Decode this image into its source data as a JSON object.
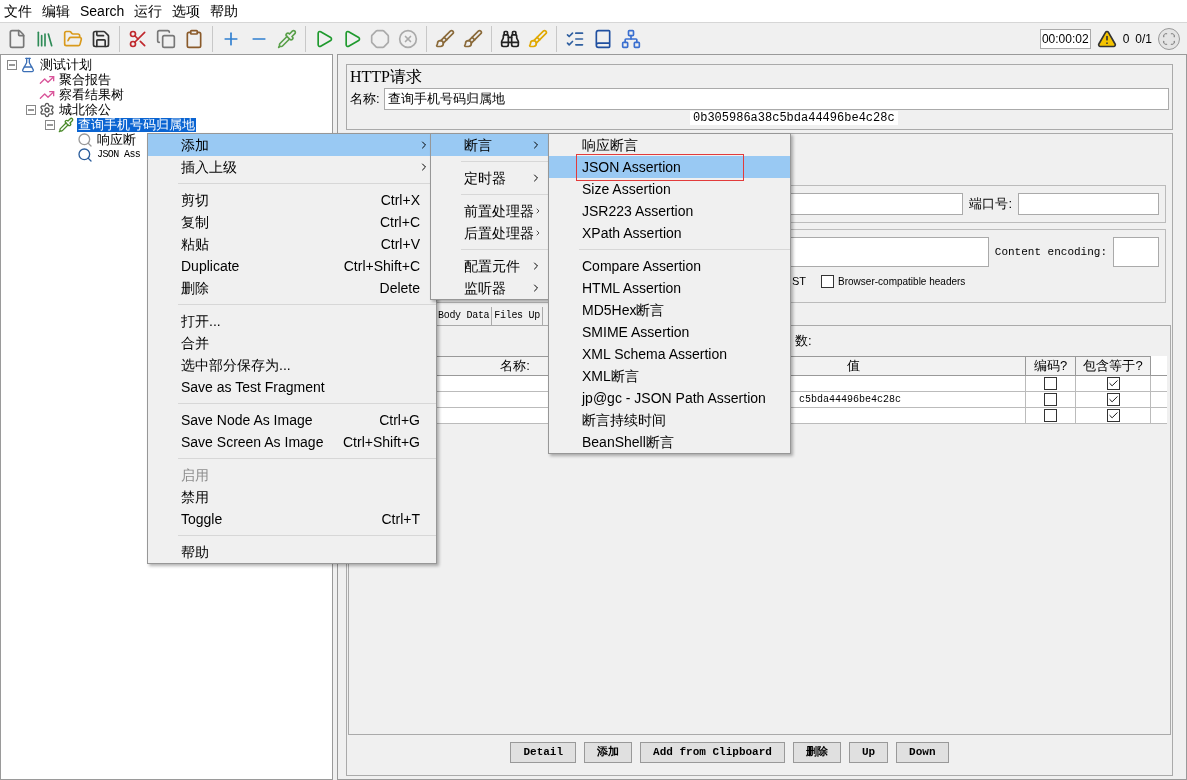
{
  "menubar": [
    {
      "label": "文件"
    },
    {
      "label": "编辑"
    },
    {
      "label": "Search"
    },
    {
      "label": "运行"
    },
    {
      "label": "选项"
    },
    {
      "label": "帮助"
    }
  ],
  "toolbar": {
    "timer": "00:00:02",
    "warnings": "0",
    "threads": "0/1"
  },
  "tree": [
    {
      "label": "测试计划",
      "kind": "plan",
      "expanded": true,
      "selected": false,
      "children": [
        {
          "label": "聚合报告",
          "kind": "listener",
          "selected": false
        },
        {
          "label": "察看结果树",
          "kind": "listener",
          "selected": false
        },
        {
          "label": "城北徐公",
          "kind": "threads",
          "expanded": true,
          "selected": false,
          "children": [
            {
              "label": "查询手机号码归属地",
              "kind": "sampler",
              "expanded": true,
              "selected": true,
              "children": [
                {
                  "label": "响应断",
                  "kind": "assertion",
                  "selected": false
                },
                {
                  "label": "JSON Ass",
                  "kind": "json_assertion",
                  "selected": false
                }
              ]
            }
          ]
        }
      ]
    }
  ],
  "editor": {
    "title": "HTTP请求",
    "name_label": "名称:",
    "name_value": "查询手机号码归属地",
    "comment_value": "0b305986a38c5bda44496be4c28c",
    "port_label": "端口号:",
    "encoding_label": "Content encoding:",
    "multipart_fragment": "ST",
    "checkbox": {
      "label": "Browser-compatible headers",
      "checked": false
    },
    "tabs": [
      {
        "label": "Body Data",
        "selected": false
      },
      {
        "label": "Files Up",
        "selected": false
      }
    ],
    "params_label": "数:",
    "table": {
      "columns": [
        "名称:",
        "值",
        "编码?",
        "包含等于?"
      ],
      "rows": [
        {
          "encode": false,
          "include_equals": true
        },
        {
          "value": "c5bda44496be4c28c",
          "encode": false,
          "include_equals": true
        },
        {
          "encode": false,
          "include_equals": true
        }
      ]
    },
    "buttons": [
      "Detail",
      "添加",
      "Add from Clipboard",
      "删除",
      "Up",
      "Down"
    ]
  },
  "context_menu": [
    {
      "kind": "item",
      "label": "添加",
      "submenu": true,
      "disabled": false,
      "selected": true
    },
    {
      "kind": "item",
      "label": "插入上级",
      "submenu": true,
      "disabled": false,
      "selected": false
    },
    {
      "kind": "separator"
    },
    {
      "kind": "item",
      "label": "剪切",
      "shortcut": "Ctrl+X",
      "submenu": false,
      "disabled": false,
      "selected": false
    },
    {
      "kind": "item",
      "label": "复制",
      "shortcut": "Ctrl+C",
      "submenu": false,
      "disabled": false,
      "selected": false
    },
    {
      "kind": "item",
      "label": "粘贴",
      "shortcut": "Ctrl+V",
      "submenu": false,
      "disabled": false,
      "selected": false
    },
    {
      "kind": "item",
      "label": "Duplicate",
      "shortcut": "Ctrl+Shift+C",
      "submenu": false,
      "disabled": false,
      "selected": false
    },
    {
      "kind": "item",
      "label": "删除",
      "shortcut": "Delete",
      "submenu": false,
      "disabled": false,
      "selected": false
    },
    {
      "kind": "separator"
    },
    {
      "kind": "item",
      "label": "打开...",
      "submenu": false,
      "disabled": false,
      "selected": false
    },
    {
      "kind": "item",
      "label": "合并",
      "submenu": false,
      "disabled": false,
      "selected": false
    },
    {
      "kind": "item",
      "label": "选中部分保存为...",
      "submenu": false,
      "disabled": false,
      "selected": false
    },
    {
      "kind": "item",
      "label": "Save as Test Fragment",
      "submenu": false,
      "disabled": false,
      "selected": false
    },
    {
      "kind": "separator"
    },
    {
      "kind": "item",
      "label": "Save Node As Image",
      "shortcut": "Ctrl+G",
      "submenu": false,
      "disabled": false,
      "selected": false
    },
    {
      "kind": "item",
      "label": "Save Screen As Image",
      "shortcut": "Ctrl+Shift+G",
      "submenu": false,
      "disabled": false,
      "selected": false
    },
    {
      "kind": "separator"
    },
    {
      "kind": "item",
      "label": "启用",
      "submenu": false,
      "disabled": true,
      "selected": false
    },
    {
      "kind": "item",
      "label": "禁用",
      "submenu": false,
      "disabled": false,
      "selected": false
    },
    {
      "kind": "item",
      "label": "Toggle",
      "shortcut": "Ctrl+T",
      "submenu": false,
      "disabled": false,
      "selected": false
    },
    {
      "kind": "separator"
    },
    {
      "kind": "item",
      "label": "帮助",
      "submenu": false,
      "disabled": false,
      "selected": false
    }
  ],
  "add_menu": [
    {
      "kind": "item",
      "label": "断言",
      "submenu": true,
      "selected": true
    },
    {
      "kind": "separator"
    },
    {
      "kind": "item",
      "label": "定时器",
      "submenu": true,
      "selected": false
    },
    {
      "kind": "separator"
    },
    {
      "kind": "item",
      "label": "前置处理器",
      "submenu": true,
      "selected": false
    },
    {
      "kind": "item",
      "label": "后置处理器",
      "submenu": true,
      "selected": false
    },
    {
      "kind": "separator"
    },
    {
      "kind": "item",
      "label": "配置元件",
      "submenu": true,
      "selected": false
    },
    {
      "kind": "item",
      "label": "监听器",
      "submenu": true,
      "selected": false
    }
  ],
  "assertion_menu": [
    {
      "kind": "item",
      "label": "响应断言",
      "selected": false,
      "outlined": false
    },
    {
      "kind": "item",
      "label": "JSON Assertion",
      "selected": true,
      "outlined": true
    },
    {
      "kind": "item",
      "label": "Size Assertion",
      "selected": false,
      "outlined": false
    },
    {
      "kind": "item",
      "label": "JSR223 Assertion",
      "selected": false,
      "outlined": false
    },
    {
      "kind": "item",
      "label": "XPath Assertion",
      "selected": false,
      "outlined": false
    },
    {
      "kind": "separator"
    },
    {
      "kind": "item",
      "label": "Compare Assertion",
      "selected": false,
      "outlined": false
    },
    {
      "kind": "item",
      "label": "HTML Assertion",
      "selected": false,
      "outlined": false
    },
    {
      "kind": "item",
      "label": "MD5Hex断言",
      "selected": false,
      "outlined": false
    },
    {
      "kind": "item",
      "label": "SMIME Assertion",
      "selected": false,
      "outlined": false
    },
    {
      "kind": "item",
      "label": "XML Schema Assertion",
      "selected": false,
      "outlined": false
    },
    {
      "kind": "item",
      "label": "XML断言",
      "selected": false,
      "outlined": false
    },
    {
      "kind": "item",
      "label": "jp@gc - JSON Path Assertion",
      "selected": false,
      "outlined": false
    },
    {
      "kind": "item",
      "label": "断言持续时间",
      "selected": false,
      "outlined": false
    },
    {
      "kind": "item",
      "label": "BeanShell断言",
      "selected": false,
      "outlined": false
    }
  ]
}
